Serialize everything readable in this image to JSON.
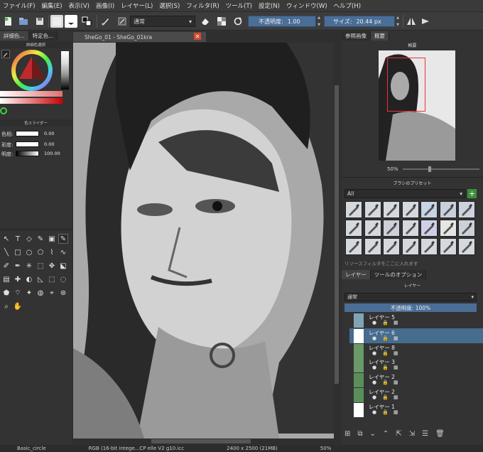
{
  "menu": [
    "ファイル(F)",
    "編集(E)",
    "表示(V)",
    "画像(I)",
    "レイヤー(L)",
    "選択(S)",
    "フィルタ(R)",
    "ツール(T)",
    "設定(N)",
    "ウィンドウ(W)",
    "ヘルプ(H)"
  ],
  "toolbar": {
    "blend_mode": "通常",
    "opacity_label": "不透明度:",
    "opacity_value": "1.00",
    "size_label": "サイズ:",
    "size_value": "20.44 px"
  },
  "left": {
    "tabs": [
      "詳細色...",
      "特定色..."
    ],
    "advanced_color_title": "詳細色選択",
    "color_slider_title": "色スライダー",
    "sliders": [
      {
        "label": "色相:",
        "value": "0.00"
      },
      {
        "label": "彩度:",
        "value": "0.00"
      },
      {
        "label": "明度:",
        "value": "100.00"
      }
    ]
  },
  "document": {
    "tab_title": "SheGo_01 - SheGo_01kra"
  },
  "right": {
    "tabs": [
      "参照画像",
      "概要"
    ],
    "overview_title": "概要",
    "zoom_label": "50%",
    "brush_presets_title": "ブラシのプリセット",
    "brush_filter": "All",
    "brush_tag_hint": "リソースフィルタをここに入れます",
    "bottom_tabs": [
      "レイヤー",
      "ツールのオプション"
    ],
    "layers_title": "レイヤー",
    "layer_blend": "通常",
    "layer_opacity": "不透明度: 100%",
    "layers": [
      {
        "name": "レイヤー 5"
      },
      {
        "name": "レイヤー 6"
      },
      {
        "name": "レイヤー 8"
      },
      {
        "name": "レイヤー 3"
      },
      {
        "name": "レイヤー 2"
      },
      {
        "name": "レイヤー 2"
      },
      {
        "name": "レイヤー 1"
      }
    ]
  },
  "status": {
    "brush": "Basic_circle",
    "color_info": "RGB (16-bit intege...CP elle V2 g10.icc",
    "dims": "2400 x 2500 (21MB)",
    "zoom": "50%"
  }
}
